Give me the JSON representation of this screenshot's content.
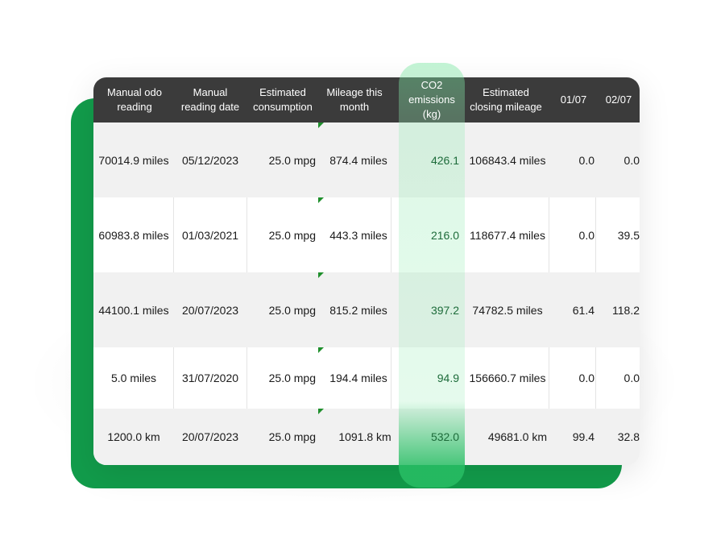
{
  "table": {
    "headers": {
      "manual_odo_reading": "Manual odo reading",
      "manual_reading_date": "Manual reading date",
      "estimated_consumption": "Estimated consumption",
      "mileage_this_month": "Mileage this month",
      "co2_emissions": "CO2 emissions (kg)",
      "estimated_closing_mileage": "Estimated closing mileage",
      "day_0107": "01/07",
      "day_0207": "02/07"
    },
    "rows": [
      {
        "odo": "70014.9 miles",
        "date": "05/12/2023",
        "consumption": "25.0 mpg",
        "mileage": "874.4 miles",
        "co2": "426.1",
        "closing": "106843.4 miles",
        "d1": "0.0",
        "d2": "0.0"
      },
      {
        "odo": "60983.8 miles",
        "date": "01/03/2021",
        "consumption": "25.0 mpg",
        "mileage": "443.3 miles",
        "co2": "216.0",
        "closing": "118677.4 miles",
        "d1": "0.0",
        "d2": "39.5"
      },
      {
        "odo": "44100.1 miles",
        "date": "20/07/2023",
        "consumption": "25.0 mpg",
        "mileage": "815.2 miles",
        "co2": "397.2",
        "closing": "74782.5 miles",
        "d1": "61.4",
        "d2": "118.2"
      },
      {
        "odo": "5.0 miles",
        "date": "31/07/2020",
        "consumption": "25.0 mpg",
        "mileage": "194.4 miles",
        "co2": "94.9",
        "closing": "156660.7 miles",
        "d1": "0.0",
        "d2": "0.0"
      },
      {
        "odo": "1200.0 km",
        "date": "20/07/2023",
        "consumption": "25.0 mpg",
        "mileage": "1091.8 km",
        "co2": "532.0",
        "closing": "49681.0 km",
        "d1": "99.4",
        "d2": "32.8"
      }
    ]
  },
  "colors": {
    "accent_green": "#129c4b",
    "header_bg": "#3b3b3b",
    "highlight_green": "#7be6a0"
  }
}
